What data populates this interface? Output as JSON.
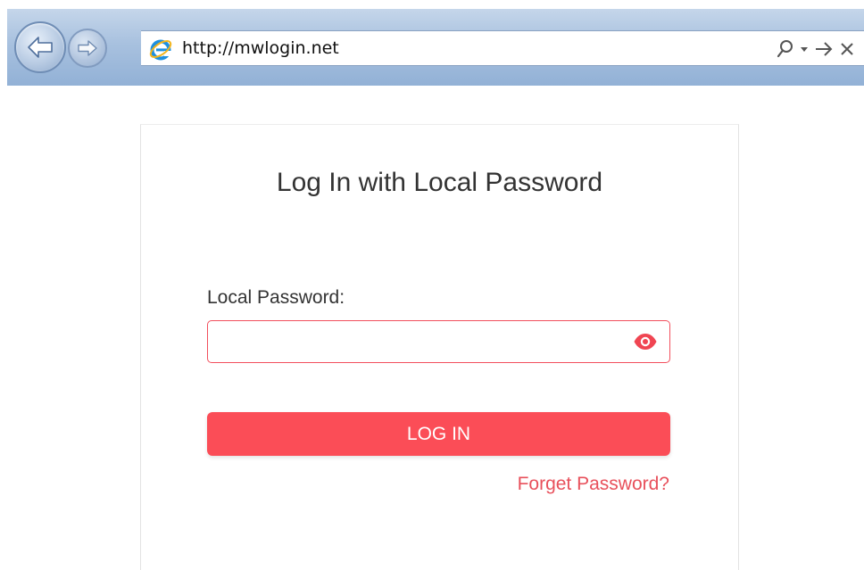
{
  "browser": {
    "url": "http://mwlogin.net",
    "icons": {
      "back": "back-arrow-icon",
      "forward": "forward-arrow-icon",
      "site": "internet-explorer-icon",
      "search": "search-icon",
      "dropdown": "dropdown-arrow-icon",
      "go": "go-arrow-icon",
      "stop": "close-icon"
    }
  },
  "login": {
    "title": "Log In with Local Password",
    "password_label": "Local Password:",
    "password_value": "",
    "show_password_icon": "eye-icon",
    "login_button": "LOG IN",
    "forget_link": "Forget Password?"
  },
  "colors": {
    "accent": "#fb4d57",
    "link": "#e8505b",
    "input_border": "#f24f5d",
    "toolbar": "#a8c1df"
  }
}
